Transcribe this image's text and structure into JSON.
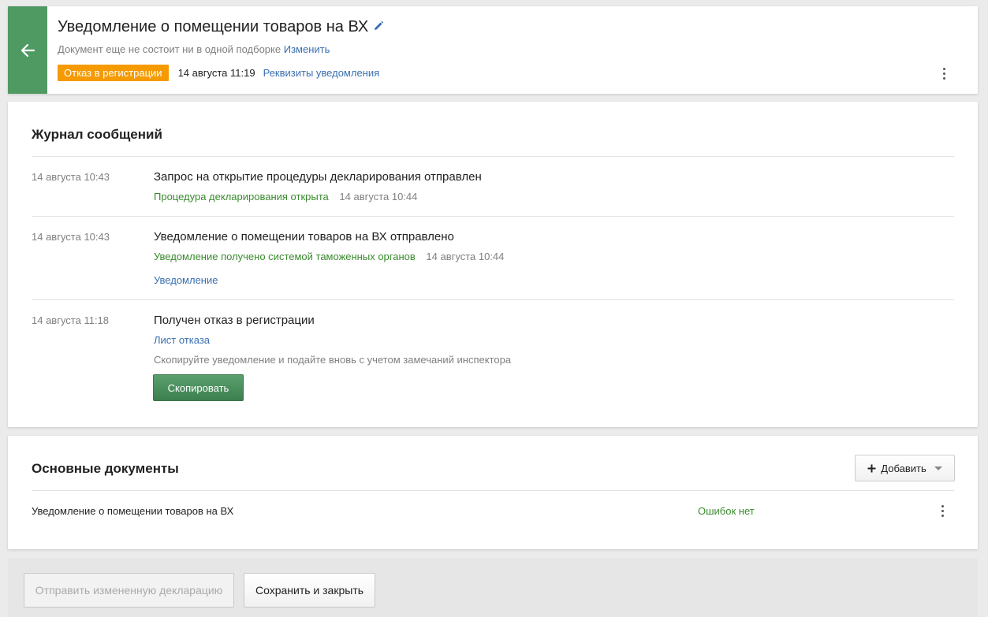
{
  "header": {
    "title": "Уведомление о помещении товаров на ВХ",
    "collection_text": "Документ еще не состоит ни в одной подборке",
    "collection_link": "Изменить",
    "status_badge": "Отказ в регистрации",
    "status_date": "14 августа 11:19",
    "requisites_link": "Реквизиты уведомления"
  },
  "journal": {
    "title": "Журнал сообщений",
    "entries": [
      {
        "date": "14 августа 10:43",
        "message": "Запрос на открытие процедуры декларирования отправлен",
        "status": "Процедура декларирования открыта",
        "status_date": "14 августа 10:44"
      },
      {
        "date": "14 августа 10:43",
        "message": "Уведомление о помещении товаров на ВХ отправлено",
        "status": "Уведомление получено системой таможенных органов",
        "status_date": "14 августа 10:44",
        "link": "Уведомление"
      },
      {
        "date": "14 августа 11:18",
        "message": "Получен отказ в регистрации",
        "link": "Лист отказа",
        "hint": "Скопируйте уведомление и подайте вновь с учетом замечаний инспектора",
        "button": "Скопировать"
      }
    ]
  },
  "documents": {
    "title": "Основные документы",
    "add_button": "Добавить",
    "rows": [
      {
        "name": "Уведомление о помещении товаров на ВХ",
        "status": "Ошибок нет"
      }
    ]
  },
  "footer": {
    "send_button": "Отправить измененную декларацию",
    "save_button": "Сохранить и закрыть"
  },
  "colors": {
    "accent_green": "#4f9a62",
    "badge_orange": "#f59a00",
    "link_blue": "#3a6fb0",
    "status_green": "#3a8a2e"
  },
  "icons": [
    "arrow-left-icon",
    "pencil-icon",
    "kebab-icon",
    "plus-icon",
    "caret-down-icon"
  ]
}
